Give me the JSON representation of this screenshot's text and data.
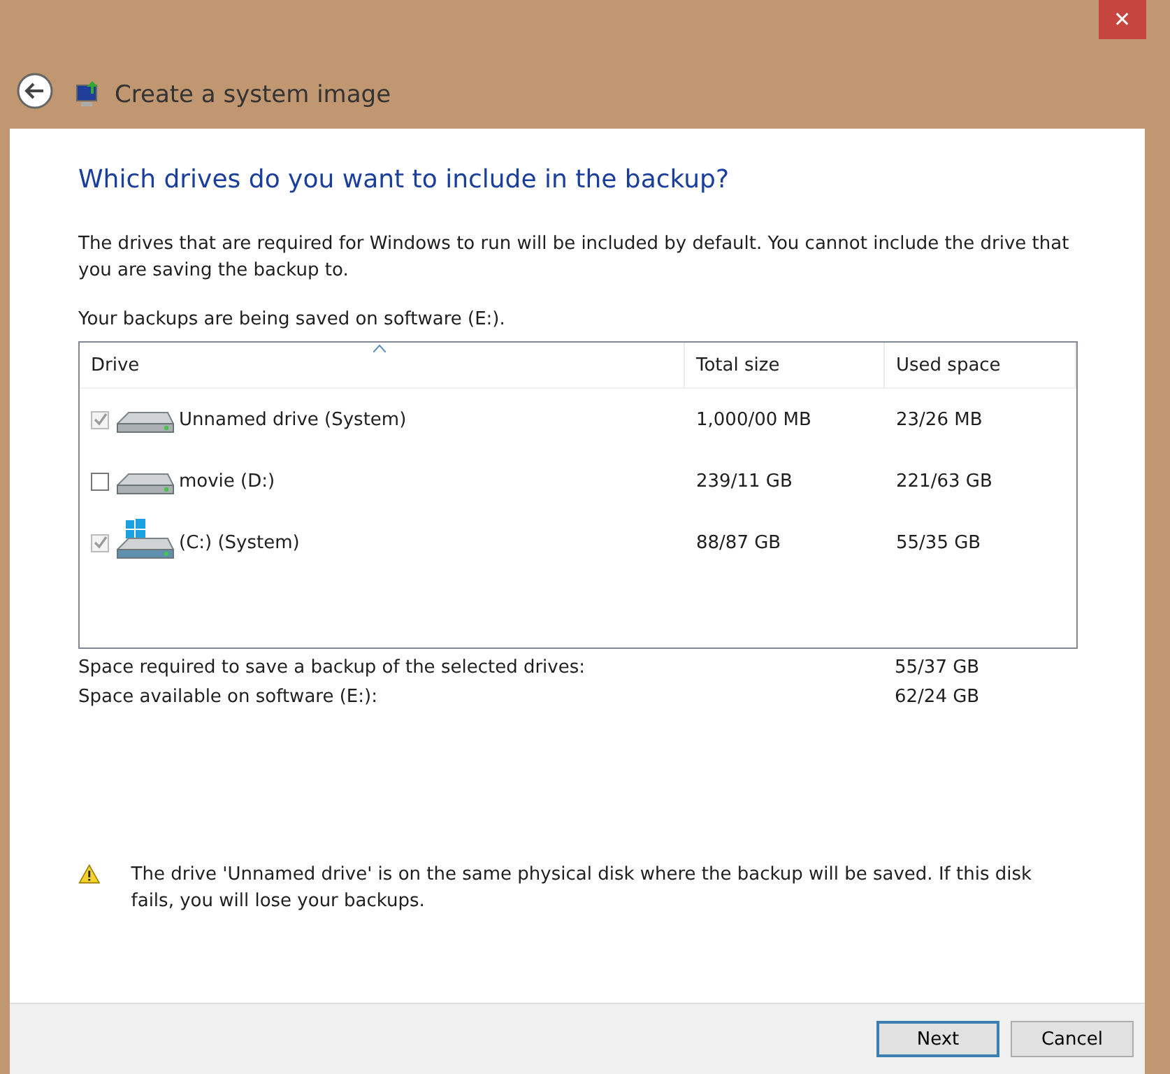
{
  "window": {
    "title": "Create a system image",
    "close": "✕"
  },
  "heading": "Which drives do you want to include in the backup?",
  "description": "The drives that are required for Windows to run will be included by default. You cannot include the drive that you are saving the backup to.",
  "save_location": "Your backups are being saved on software (E:).",
  "table": {
    "columns": [
      "Drive",
      "Total size",
      "Used space"
    ],
    "rows": [
      {
        "name": "Unnamed drive (System)",
        "total": "1,000/00 MB",
        "used": "23/26 MB",
        "checked": true,
        "disabled": true,
        "kind": "disk"
      },
      {
        "name": "movie (D:)",
        "total": "239/11 GB",
        "used": "221/63 GB",
        "checked": false,
        "disabled": false,
        "kind": "disk"
      },
      {
        "name": "(C:) (System)",
        "total": "88/87 GB",
        "used": "55/35 GB",
        "checked": true,
        "disabled": true,
        "kind": "windows"
      }
    ]
  },
  "summary": [
    {
      "label": "Space required to save a backup of the selected drives:",
      "value": "55/37 GB"
    },
    {
      "label": "Space available on software (E:):",
      "value": "62/24 GB"
    }
  ],
  "warning": "The drive 'Unnamed drive' is on the same physical disk where the backup will be saved. If this disk fails, you will lose your backups.",
  "buttons": [
    {
      "label": "Next",
      "default": true
    },
    {
      "label": "Cancel",
      "default": false
    }
  ]
}
